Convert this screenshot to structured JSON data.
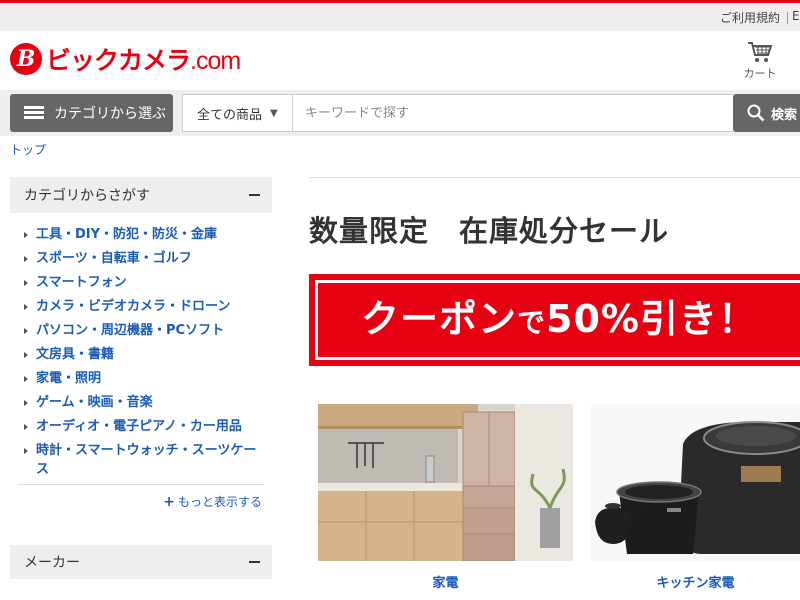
{
  "topbar": {
    "terms_link": "ご利用規約"
  },
  "logo": {
    "text": "ビックカメラ",
    "suffix": ".com"
  },
  "cart": {
    "label": "カート"
  },
  "search": {
    "category_button": "カテゴリから選ぶ",
    "scope": "全ての商品",
    "placeholder": "キーワードで探す",
    "button": "検索"
  },
  "breadcrumb": "トップ",
  "sidebar": {
    "category_heading": "カテゴリからさがす",
    "categories": [
      "工具・DIY・防犯・防災・金庫",
      "スポーツ・自転車・ゴルフ",
      "スマートフォン",
      "カメラ・ビデオカメラ・ドローン",
      "パソコン・周辺機器・PCソフト",
      "文房具・書籍",
      "家電・照明",
      "ゲーム・映画・音楽",
      "オーディオ・電子ピアノ・カー用品",
      "時計・スマートウォッチ・スーツケース"
    ],
    "more_link": "もっと表示する",
    "maker_heading": "メーカー"
  },
  "main": {
    "title": "数量限定　在庫処分セール",
    "banner_pre": "クーポン",
    "banner_mid": "で",
    "banner_big": "50%引き！",
    "tiles": [
      {
        "label": "家電"
      },
      {
        "label": "キッチン家電"
      }
    ]
  },
  "colors": {
    "brand_red": "#e50012",
    "link_blue": "#1a5bb5",
    "button_gray": "#666666"
  }
}
